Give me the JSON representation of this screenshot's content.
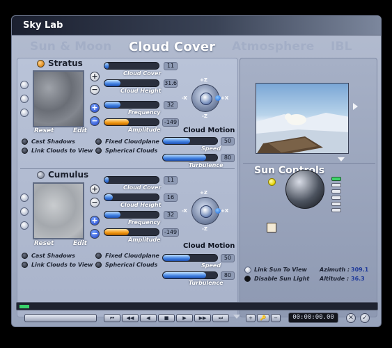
{
  "window": {
    "title": "Sky Lab"
  },
  "tabs": [
    {
      "label": "Sun & Moon",
      "active": false
    },
    {
      "label": "Cloud Cover",
      "active": true
    },
    {
      "label": "Atmosphere",
      "active": false
    },
    {
      "label": "IBL",
      "active": false
    }
  ],
  "stratus": {
    "title": "Stratus",
    "reset": "Reset",
    "edit": "Edit",
    "sliders": [
      {
        "label": "Cloud Cover",
        "value": "11",
        "fill_pct": 8,
        "color": "blue"
      },
      {
        "label": "Cloud Height",
        "value": "31.6",
        "fill_pct": 30,
        "color": "blue"
      },
      {
        "label": "Frequency",
        "value": "32",
        "fill_pct": 30,
        "color": "blue"
      },
      {
        "label": "Amplitude",
        "value": "-149",
        "fill_pct": 45,
        "color": "orange"
      }
    ],
    "motion_title": "Cloud Motion",
    "motion_sliders": [
      {
        "label": "Speed",
        "value": "50",
        "fill_pct": 50,
        "color": "blue"
      },
      {
        "label": "Turbulence",
        "value": "80",
        "fill_pct": 80,
        "color": "blue"
      }
    ],
    "options": {
      "cast_shadows": "Cast Shadows",
      "link_clouds": "Link Clouds to View",
      "fixed_cloudplane": "Fixed Cloudplane",
      "spherical_clouds": "Spherical Clouds"
    },
    "axes": {
      "top": "+Z",
      "bottom": "-Z",
      "left": "-X",
      "right": "+X"
    }
  },
  "cumulus": {
    "title": "Cumulus",
    "reset": "Reset",
    "edit": "Edit",
    "sliders": [
      {
        "label": "Cloud Cover",
        "value": "11",
        "fill_pct": 8,
        "color": "blue"
      },
      {
        "label": "Cloud Height",
        "value": "16",
        "fill_pct": 16,
        "color": "blue"
      },
      {
        "label": "Frequency",
        "value": "32",
        "fill_pct": 30,
        "color": "blue"
      },
      {
        "label": "Amplitude",
        "value": "-149",
        "fill_pct": 45,
        "color": "orange"
      }
    ],
    "motion_title": "Cloud Motion",
    "motion_sliders": [
      {
        "label": "Speed",
        "value": "50",
        "fill_pct": 50,
        "color": "blue"
      },
      {
        "label": "Turbulence",
        "value": "80",
        "fill_pct": 80,
        "color": "blue"
      }
    ],
    "options": {
      "cast_shadows": "Cast Shadows",
      "link_clouds": "Link Clouds to View",
      "fixed_cloudplane": "Fixed Cloudplane",
      "spherical_clouds": "Spherical Clouds"
    },
    "axes": {
      "top": "+Z",
      "bottom": "-Z",
      "left": "-X",
      "right": "+X"
    }
  },
  "sun": {
    "title": "Sun Controls",
    "link_sun": "Link Sun To View",
    "disable_sun": "Disable Sun Light",
    "azimuth_label": "Azimuth :",
    "azimuth_value": "309.1",
    "altitude_label": "Altitude :",
    "altitude_value": "36.3"
  },
  "transport": {
    "timecode": "00:00:00.00"
  },
  "colors": {
    "accent_blue": "#3f7fe0",
    "accent_orange": "#f0960f",
    "window_bg": "#a9b3ca"
  }
}
